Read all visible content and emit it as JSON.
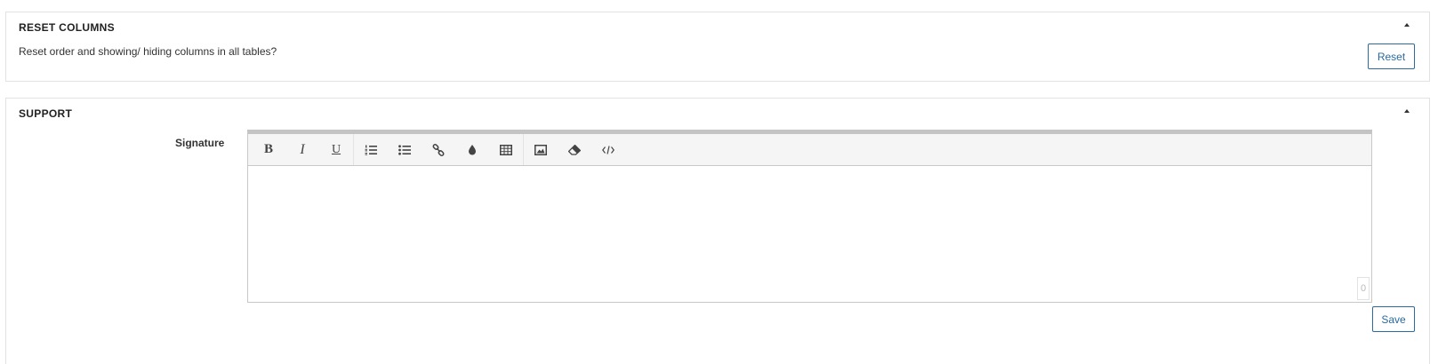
{
  "reset_columns": {
    "title": "RESET COLUMNS",
    "description": "Reset order and showing/ hiding columns in all tables?",
    "reset_label": "Reset"
  },
  "support": {
    "title": "SUPPORT",
    "signature_label": "Signature",
    "save_label": "Save",
    "char_count": "0",
    "toolbar": {
      "bold": "B",
      "italic": "I",
      "underline": "U",
      "icons": [
        "bold-icon",
        "italic-icon",
        "underline-icon",
        "ordered-list-icon",
        "unordered-list-icon",
        "link-icon",
        "color-drop-icon",
        "table-icon",
        "image-icon",
        "eraser-icon",
        "code-view-icon"
      ]
    }
  },
  "colors": {
    "accent": "#2a6aa0",
    "border": "#e2e2e2",
    "toolbar_bg": "#f5f5f5"
  }
}
